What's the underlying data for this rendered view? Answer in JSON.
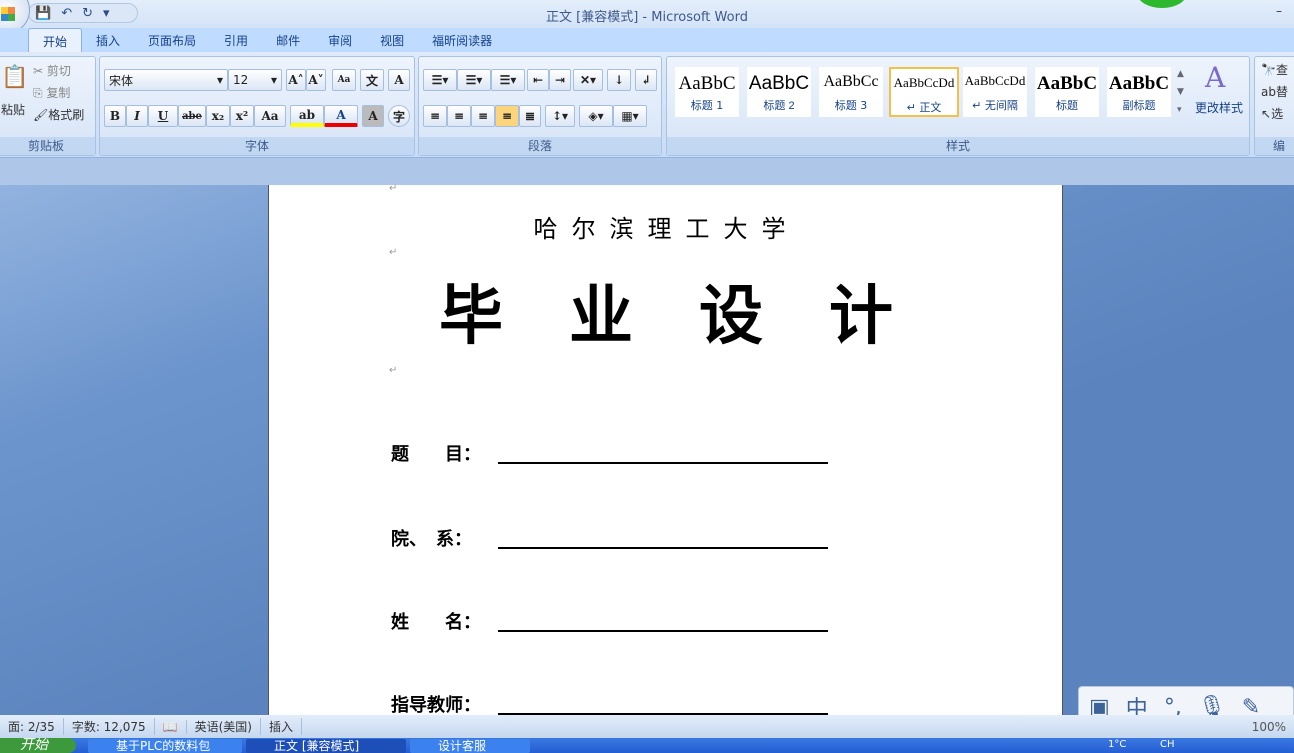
{
  "title": "正文 [兼容模式] - Microsoft Word",
  "tabs": [
    "开始",
    "插入",
    "页面布局",
    "引用",
    "邮件",
    "审阅",
    "视图",
    "福昕阅读器"
  ],
  "clipboard": {
    "paste": "粘贴",
    "cut": "剪切",
    "copy": "复制",
    "format_painter": "格式刷",
    "label": "剪贴板"
  },
  "font": {
    "name": "宋体",
    "size": "12",
    "label": "字体",
    "bold": "B",
    "italic": "I",
    "underline": "U",
    "strike": "abe",
    "sub": "x₂",
    "sup": "x²",
    "case": "Aa",
    "grow": "A˄",
    "shrink": "A˅",
    "clear": "A",
    "color": "A",
    "shade": "A",
    "enclose": "字",
    "phonetic": "文"
  },
  "paragraph": {
    "label": "段落"
  },
  "styles": {
    "label": "样式",
    "items": [
      {
        "preview": "AaBbC",
        "name": "标题 1"
      },
      {
        "preview": "AaBbC",
        "name": "标题 2"
      },
      {
        "preview": "AaBbCc",
        "name": "标题 3"
      },
      {
        "preview": "AaBbCcDd",
        "name": "↵ 正文"
      },
      {
        "preview": "AaBbCcDd",
        "name": "↵ 无间隔"
      },
      {
        "preview": "AaBbC",
        "name": "标题"
      },
      {
        "preview": "AaBbC",
        "name": "副标题"
      }
    ],
    "change": "更改样式"
  },
  "editing": {
    "find": "查",
    "replace": "替",
    "select": "选",
    "label": "编"
  },
  "document": {
    "university": "哈尔滨理工大学",
    "heading": [
      "毕",
      "业",
      "设",
      "计"
    ],
    "fields": [
      "题　　目：",
      "院、　系：",
      "姓　　名：",
      "指导教师："
    ]
  },
  "status": {
    "page": "面: 2/35",
    "words": "字数: 12,075",
    "lang": "英语(美国)",
    "mode": "插入",
    "zoom": "100%"
  },
  "taskbar": {
    "start": "开始",
    "items": [
      "基于PLC的数料包",
      "正文 [兼容模式]",
      "设计客服"
    ],
    "temp": "1°C",
    "ime": "CH"
  },
  "ime_bar": [
    "中",
    "°,"
  ]
}
